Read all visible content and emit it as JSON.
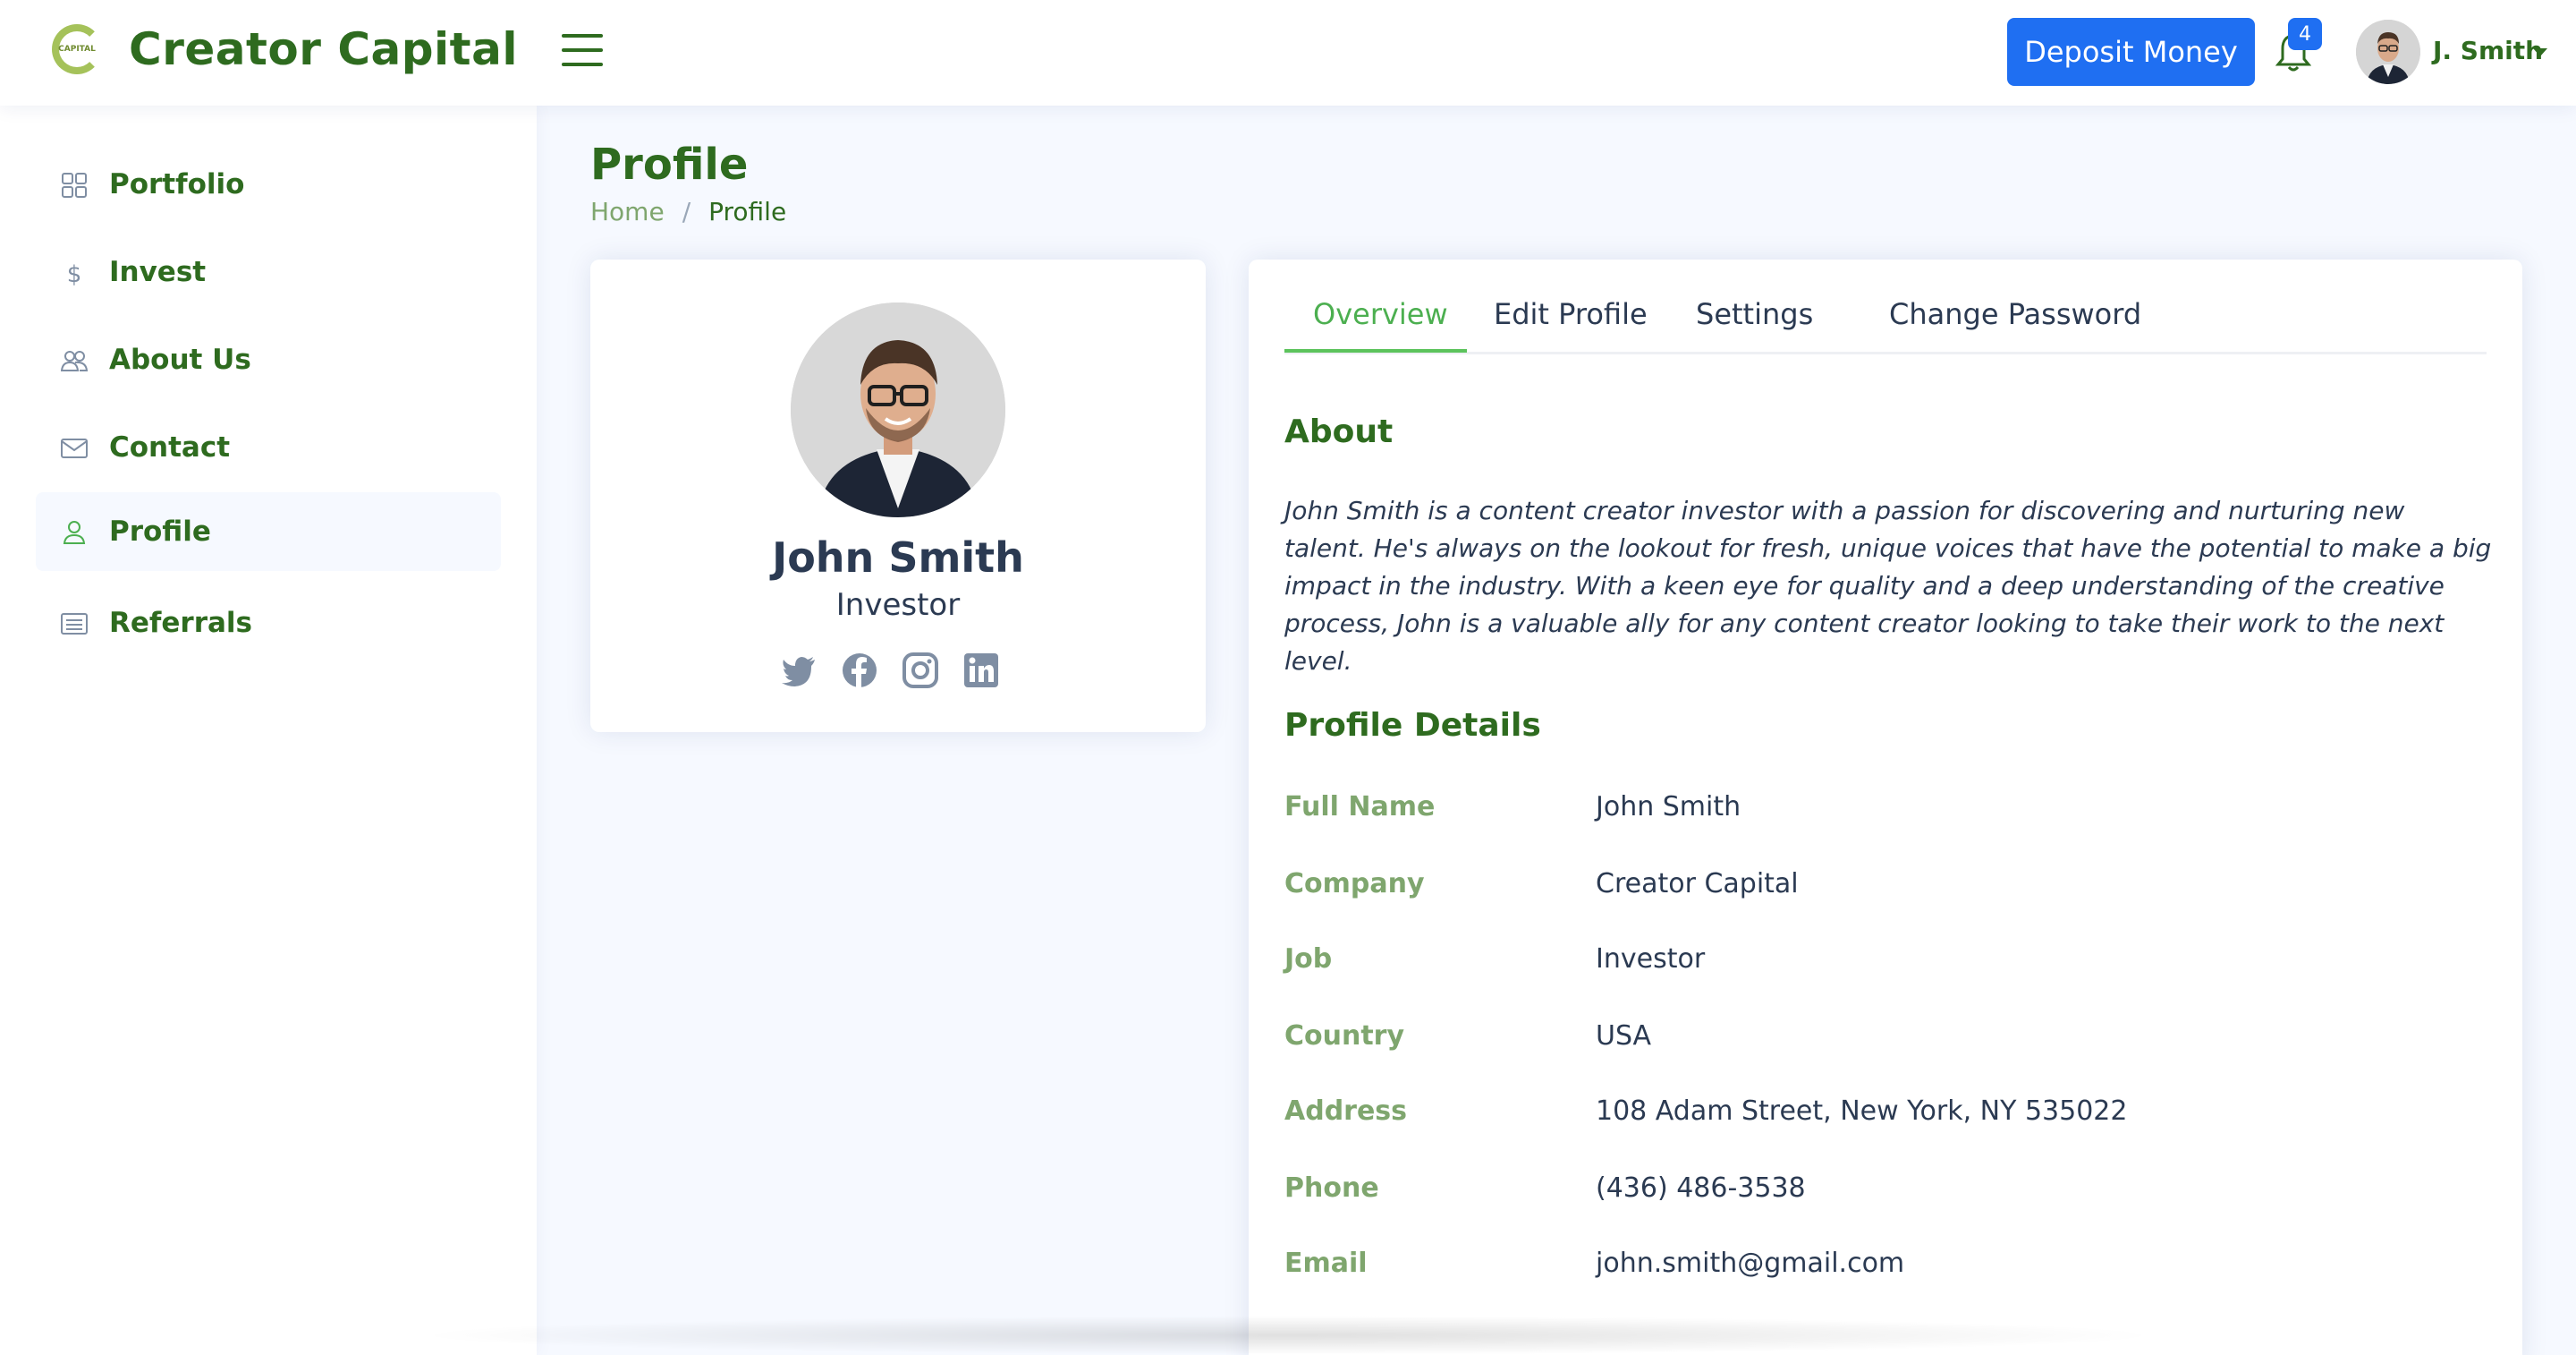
{
  "brand": {
    "name": "Creator Capital",
    "logo_text": "CAPITAL",
    "color": "#2e6b1f",
    "accent": "#1f6ff2"
  },
  "header": {
    "deposit_label": "Deposit Money",
    "notification_count": "4",
    "user_name": "J. Smith"
  },
  "sidebar": {
    "items": [
      {
        "label": "Portfolio",
        "icon": "grid-icon"
      },
      {
        "label": "Invest",
        "icon": "dollar-icon"
      },
      {
        "label": "About Us",
        "icon": "people-icon"
      },
      {
        "label": "Contact",
        "icon": "envelope-icon"
      },
      {
        "label": "Profile",
        "icon": "person-icon",
        "active": true
      },
      {
        "label": "Referrals",
        "icon": "list-icon"
      }
    ]
  },
  "page": {
    "title": "Profile",
    "breadcrumb": {
      "home": "Home",
      "separator": "/",
      "current": "Profile"
    }
  },
  "profile_card": {
    "name": "John Smith",
    "role": "Investor",
    "socials": [
      "twitter-icon",
      "facebook-icon",
      "instagram-icon",
      "linkedin-icon"
    ]
  },
  "tabs": [
    "Overview",
    "Edit Profile",
    "Settings",
    "Change Password"
  ],
  "about": {
    "title": "About",
    "text": "John Smith is a content creator investor with a passion for discovering and nurturing new talent. He's always on the lookout for fresh, unique voices that have the potential to make a big impact in the industry. With a keen eye for quality and a deep understanding of the creative process, John is a valuable ally for any content creator looking to take their work to the next level."
  },
  "details": {
    "title": "Profile Details",
    "rows": [
      {
        "label": "Full Name",
        "value": "John Smith"
      },
      {
        "label": "Company",
        "value": "Creator Capital"
      },
      {
        "label": "Job",
        "value": "Investor"
      },
      {
        "label": "Country",
        "value": "USA"
      },
      {
        "label": "Address",
        "value": "108 Adam Street, New York, NY 535022"
      },
      {
        "label": "Phone",
        "value": "(436) 486-3538"
      },
      {
        "label": "Email",
        "value": "john.smith@gmail.com"
      }
    ]
  }
}
